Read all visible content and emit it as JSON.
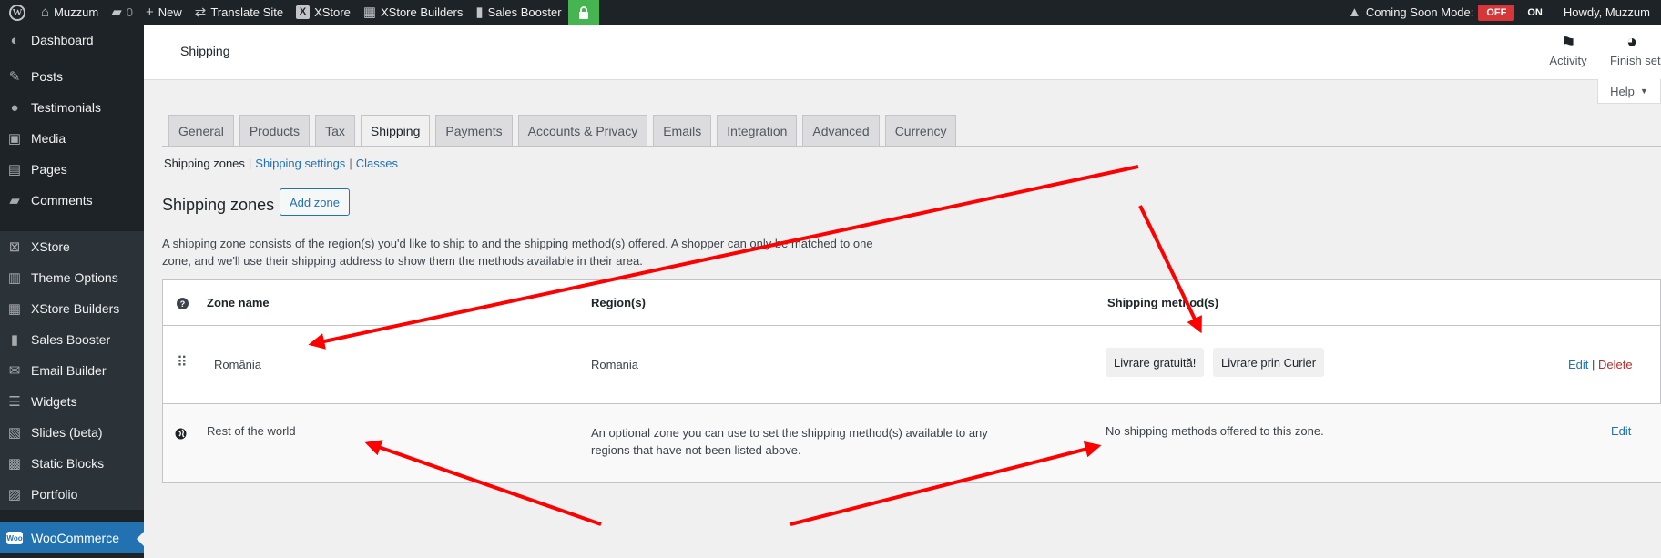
{
  "adminbar": {
    "site_name": "Muzzum",
    "comments_count": "0",
    "new_label": "New",
    "translate_label": "Translate Site",
    "xstore_label": "XStore",
    "builders_label": "XStore Builders",
    "booster_label": "Sales Booster",
    "coming_soon_label": "Coming Soon Mode:",
    "off_label": "OFF",
    "on_label": "ON",
    "howdy": "Howdy, Muzzum"
  },
  "sidebar": {
    "items": [
      {
        "label": "Dashboard",
        "icon": "dashboard-icon"
      },
      {
        "label": "Posts",
        "icon": "pin-icon"
      },
      {
        "label": "Testimonials",
        "icon": "speech-bubble-icon"
      },
      {
        "label": "Media",
        "icon": "media-icon"
      },
      {
        "label": "Pages",
        "icon": "pages-icon"
      },
      {
        "label": "Comments",
        "icon": "comment-icon"
      },
      {
        "label": "XStore",
        "icon": "xstore-icon"
      },
      {
        "label": "Theme Options",
        "icon": "theme-options-icon"
      },
      {
        "label": "XStore Builders",
        "icon": "builders-icon"
      },
      {
        "label": "Sales Booster",
        "icon": "bar-chart-icon"
      },
      {
        "label": "Email Builder",
        "icon": "envelope-icon"
      },
      {
        "label": "Widgets",
        "icon": "widgets-icon"
      },
      {
        "label": "Slides (beta)",
        "icon": "slides-icon"
      },
      {
        "label": "Static Blocks",
        "icon": "blocks-icon"
      },
      {
        "label": "Portfolio",
        "icon": "portfolio-icon"
      },
      {
        "label": "WooCommerce",
        "icon": "woocommerce-icon"
      }
    ]
  },
  "header": {
    "title": "Shipping",
    "activity_label": "Activity",
    "finish_setup_label": "Finish setu",
    "help_label": "Help"
  },
  "tabs": [
    "General",
    "Products",
    "Tax",
    "Shipping",
    "Payments",
    "Accounts & Privacy",
    "Emails",
    "Integration",
    "Advanced",
    "Currency"
  ],
  "active_tab": "Shipping",
  "subnav": {
    "current": "Shipping zones",
    "settings": "Shipping settings",
    "classes": "Classes",
    "separator": "|"
  },
  "zones": {
    "title": "Shipping zones",
    "add_zone": "Add zone",
    "description": "A shipping zone consists of the region(s) you'd like to ship to and the shipping method(s) offered. A shopper can only be matched to one zone, and we'll use their shipping address to show them the methods available in their area."
  },
  "table": {
    "headers": {
      "zone_name": "Zone name",
      "regions": "Region(s)",
      "methods": "Shipping method(s)"
    },
    "rows": [
      {
        "zone_name": "România",
        "region": "Romania",
        "methods": [
          "Livrare gratuită!",
          "Livrare prin Curier"
        ],
        "edit": "Edit",
        "delete": "Delete",
        "separator": "|"
      },
      {
        "zone_name": "Rest of the world",
        "region": "An optional zone you can use to set the shipping method(s) available to any regions that have not been listed above.",
        "methods_text": "No shipping methods offered to this zone.",
        "edit": "Edit"
      }
    ]
  },
  "colors": {
    "accent": "#2271b1",
    "arrow": "#ff0000",
    "off_badge": "#d63638",
    "lock": "#46b450"
  }
}
